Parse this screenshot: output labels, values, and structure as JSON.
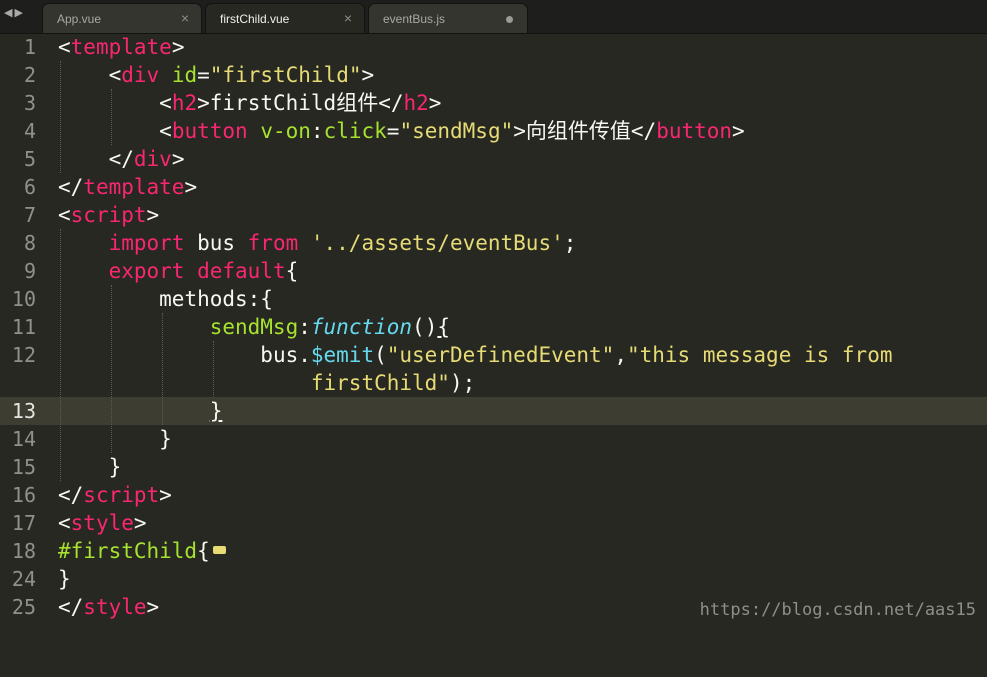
{
  "tabs": [
    {
      "label": "App.vue",
      "state": "close"
    },
    {
      "label": "firstChild.vue",
      "state": "close"
    },
    {
      "label": "eventBus.js",
      "state": "modified"
    }
  ],
  "active_tab": "firstChild.vue",
  "line_numbers": [
    "1",
    "2",
    "3",
    "4",
    "5",
    "6",
    "7",
    "8",
    "9",
    "10",
    "11",
    "12",
    "13",
    "14",
    "15",
    "16",
    "17",
    "18",
    "24",
    "25"
  ],
  "current_line": "13",
  "code": {
    "l1_open": "<",
    "l1_tag": "template",
    "l1_close": ">",
    "l2_open": "<",
    "l2_tag": "div",
    "l2_attr": "id",
    "l2_eq": "=",
    "l2_val": "\"firstChild\"",
    "l2_close": ">",
    "l3_open": "<",
    "l3_tag": "h2",
    "l3_close": ">",
    "l3_text": "firstChild组件",
    "l3_end_open": "</",
    "l3_end_tag": "h2",
    "l3_end_close": ">",
    "l4_open": "<",
    "l4_tag": "button",
    "l4_attr": "v-on",
    "l4_colon": ":",
    "l4_attr2": "click",
    "l4_eq": "=",
    "l4_val": "\"sendMsg\"",
    "l4_close": ">",
    "l4_text": "向组件传值",
    "l4_end_open": "</",
    "l4_end_tag": "button",
    "l4_end_close": ">",
    "l5_open": "</",
    "l5_tag": "div",
    "l5_close": ">",
    "l6_open": "</",
    "l6_tag": "template",
    "l6_close": ">",
    "l7_open": "<",
    "l7_tag": "script",
    "l7_close": ">",
    "l8_kw": "import",
    "l8_ident": " bus ",
    "l8_kw2": "from",
    "l8_str": " '../assets/eventBus'",
    "l8_semi": ";",
    "l9_kw": "export",
    "l9_kw2": "default",
    "l9_brace": "{",
    "l10_text": "methods:{",
    "l11_name": "sendMsg",
    "l11_colon": ":",
    "l11_fn": "function",
    "l11_parens": "()",
    "l11_brace": "{",
    "l12_obj": "bus.",
    "l12_method": "$emit",
    "l12_paren": "(",
    "l12_str1": "\"userDefinedEvent\"",
    "l12_comma": ",",
    "l12_str2": "\"this message is from",
    "l12b_str": "firstChild\"",
    "l12b_end": ");",
    "l13_text": "}",
    "l14_text": "}",
    "l15_text": "}",
    "l16_open": "</",
    "l16_tag": "script",
    "l16_close": ">",
    "l17_open": "<",
    "l17_tag": "style",
    "l17_close": ">",
    "l18_sel": "#firstChild",
    "l18_brace": "{",
    "l24_text": "}",
    "l25_open": "</",
    "l25_tag": "style",
    "l25_close": ">"
  },
  "watermark": "https://blog.csdn.net/aas15",
  "colors": {
    "background": "#272822",
    "tag": "#f92672",
    "attribute": "#a6e22e",
    "string": "#e6db74",
    "function": "#66d9ef",
    "plain": "#f8f8f2",
    "current_line": "#3e3d32"
  }
}
